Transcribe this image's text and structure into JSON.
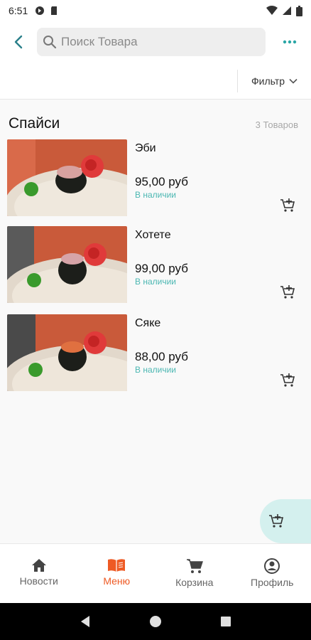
{
  "status_bar": {
    "time": "6:51"
  },
  "header": {
    "search_placeholder": "Поиск Товара"
  },
  "filter": {
    "label": "Фильтр"
  },
  "category": {
    "title": "Спайси",
    "count": "3 Товаров"
  },
  "products": [
    {
      "name": "Эби",
      "price": "95,00  руб",
      "stock": "В наличии"
    },
    {
      "name": "Хотете",
      "price": "99,00  руб",
      "stock": "В наличии"
    },
    {
      "name": "Сяке",
      "price": "88,00  руб",
      "stock": "В наличии"
    }
  ],
  "bottom_nav": [
    {
      "label": "Новости",
      "icon": "home-icon"
    },
    {
      "label": "Меню",
      "icon": "book-icon"
    },
    {
      "label": "Корзина",
      "icon": "cart-icon"
    },
    {
      "label": "Профиль",
      "icon": "profile-icon"
    }
  ],
  "colors": {
    "accent": "#ee5a24",
    "teal": "#4bb7b2",
    "fab_bg": "#d4f0ee"
  }
}
